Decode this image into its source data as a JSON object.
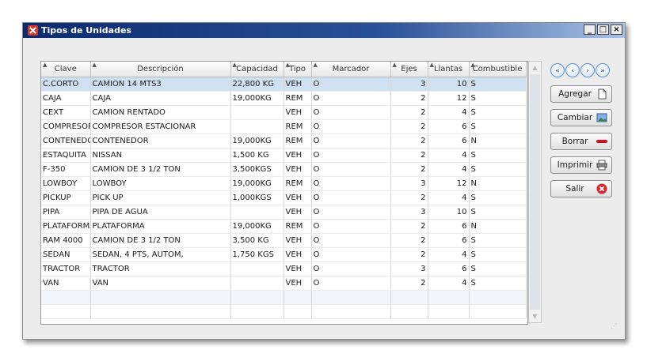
{
  "window": {
    "title": "Tipos de Unidades",
    "controls": {
      "minimize": "_",
      "maximize": "□",
      "close": "×"
    }
  },
  "grid": {
    "columns": [
      "Clave",
      "Descripción",
      "Capacidad",
      "Tipo",
      "Marcador",
      "Ejes",
      "Llantas",
      "Combustible"
    ],
    "rows": [
      [
        "C.CORTO",
        "CAMION  14 MTS3",
        "22,800 KG",
        "VEH",
        "O",
        "3",
        "10",
        "S"
      ],
      [
        "CAJA",
        "CAJA",
        "19,000KG",
        "REM",
        "O",
        "2",
        "12",
        "S"
      ],
      [
        "CEXT",
        "CAMION RENTADO",
        "",
        "VEH",
        "O",
        "2",
        "4",
        "S"
      ],
      [
        "COMPRESOR",
        "COMPRESOR ESTACIONAR",
        "",
        "REM",
        "O",
        "2",
        "6",
        "S"
      ],
      [
        "CONTENEDOR",
        "CONTENEDOR",
        "19,000KG",
        "REM",
        "O",
        "2",
        "6",
        "N"
      ],
      [
        "ESTAQUITA",
        "NISSAN",
        "1,500 KG",
        "VEH",
        "O",
        "2",
        "4",
        "S"
      ],
      [
        "F-350",
        "CAMION DE 3 1/2 TON",
        "3,500KGS",
        "VEH",
        "O",
        "2",
        "4",
        "S"
      ],
      [
        "LOWBOY",
        "LOWBOY",
        "19,000KG",
        "REM",
        "O",
        "3",
        "12",
        "N"
      ],
      [
        "PICKUP",
        "PICK UP",
        "1,000KGS",
        "VEH",
        "O",
        "2",
        "4",
        "S"
      ],
      [
        "PIPA",
        "PIPA DE AGUA",
        "",
        "VEH",
        "O",
        "3",
        "10",
        "S"
      ],
      [
        "PLATAFORMA",
        "PLATAFORMA",
        "19,000KG",
        "REM",
        "O",
        "2",
        "6",
        "N"
      ],
      [
        "RAM 4000",
        "CAMION DE 3 1/2 TON",
        "3,500 KG",
        "VEH",
        "O",
        "2",
        "6",
        "S"
      ],
      [
        "SEDAN",
        "SEDAN, 4 PTS, AUTOM,",
        "1,750 KGS",
        "VEH",
        "O",
        "2",
        "4",
        "S"
      ],
      [
        "TRACTOR",
        "TRACTOR",
        "",
        "VEH",
        "O",
        "3",
        "6",
        "S"
      ],
      [
        "VAN",
        "VAN",
        "",
        "VEH",
        "O",
        "2",
        "4",
        "S"
      ]
    ],
    "selected_row": 0
  },
  "nav": {
    "first": "«",
    "prev": "‹",
    "next": "›",
    "last": "»"
  },
  "buttons": {
    "agregar": "Agregar",
    "cambiar": "Cambiar",
    "borrar": "Borrar",
    "imprimir": "Imprimir",
    "salir": "Salir"
  },
  "icons": {
    "app": "tools-icon",
    "agregar": "new-document-icon",
    "cambiar": "picture-icon",
    "borrar": "delete-bar-icon",
    "imprimir": "printer-icon",
    "salir": "close-circle-icon"
  },
  "colors": {
    "selection": "#cfe0f3",
    "salir_icon": "#d9262c",
    "borrar_icon": "#d0101c"
  }
}
